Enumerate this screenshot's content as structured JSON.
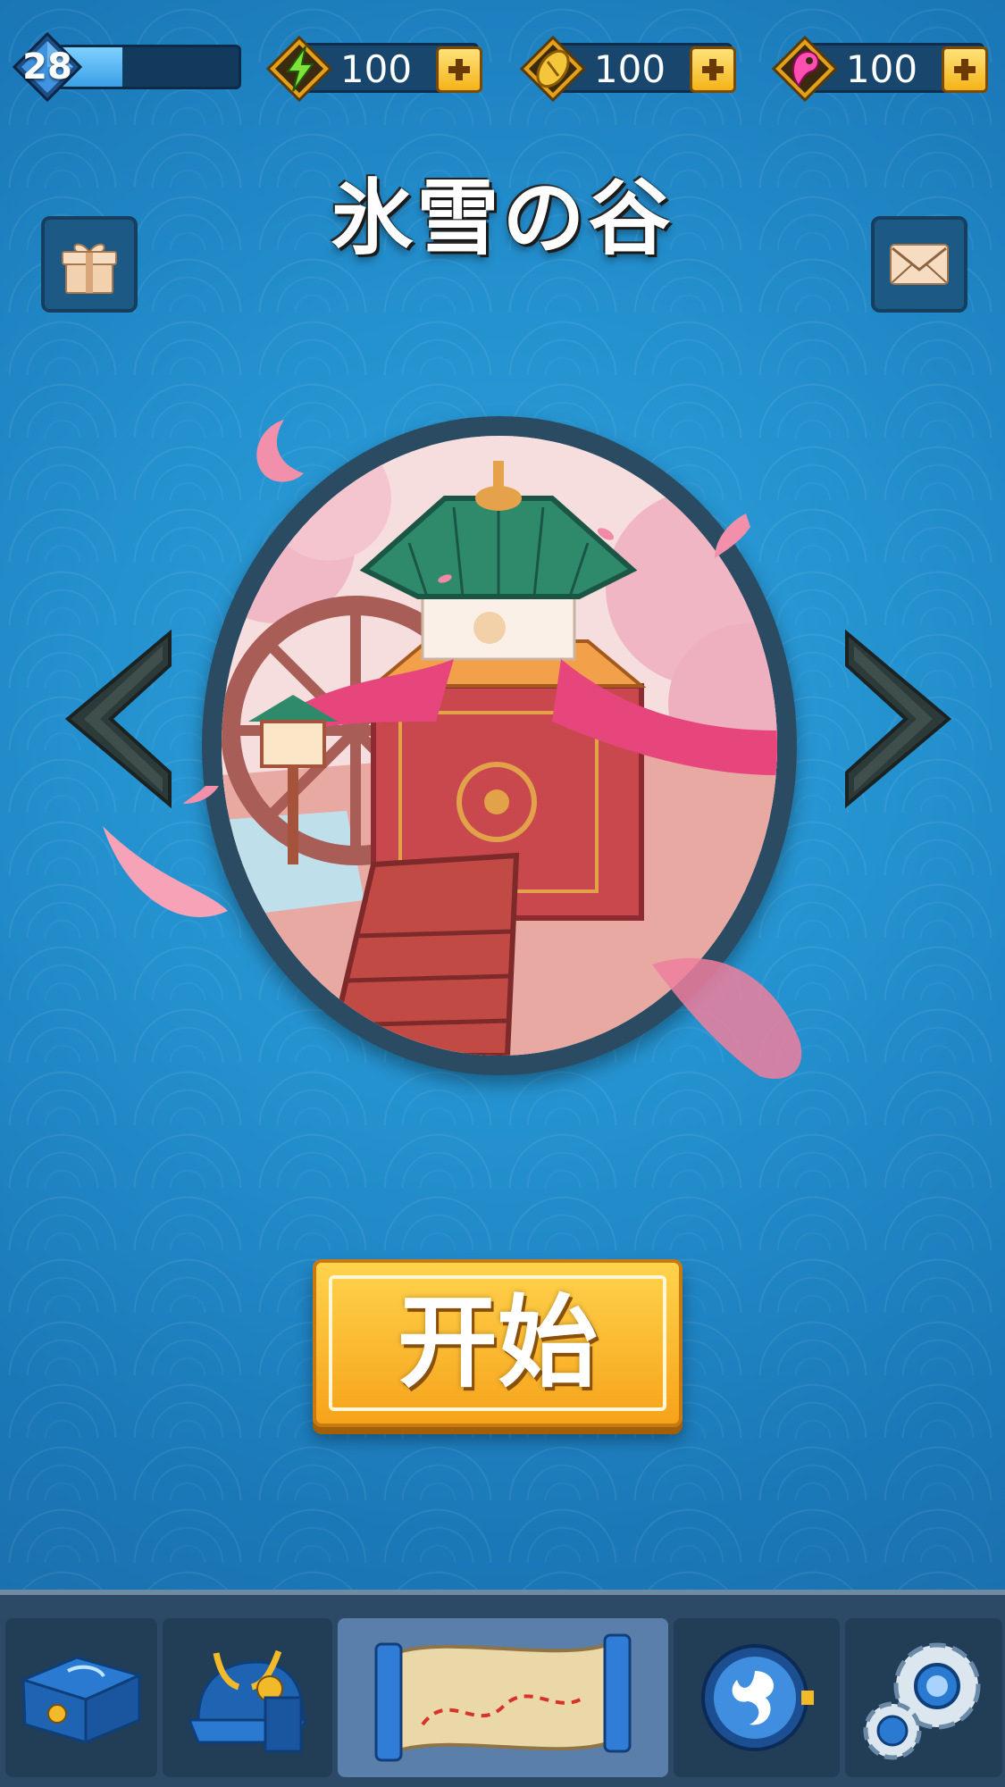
{
  "status": {
    "level": "28",
    "xp_progress": 0.35,
    "energy": "100",
    "coins": "100",
    "magatama": "100"
  },
  "stage": {
    "title": "氷雪の谷"
  },
  "start_button": {
    "label": "开始"
  },
  "colors": {
    "background": "#2491cf",
    "start_button": "#f6a31a",
    "frame": "#2b4b63"
  },
  "icons": {
    "energy": "lightning-icon",
    "coins": "gold-coin-icon",
    "magatama": "magatama-icon",
    "gift": "gift-icon",
    "mail": "mail-icon",
    "nav": [
      "treasure-chest-icon",
      "samurai-helmet-icon",
      "map-scroll-icon",
      "drum-icon",
      "settings-gears-icon"
    ]
  },
  "nav": {
    "active_index": 2
  }
}
